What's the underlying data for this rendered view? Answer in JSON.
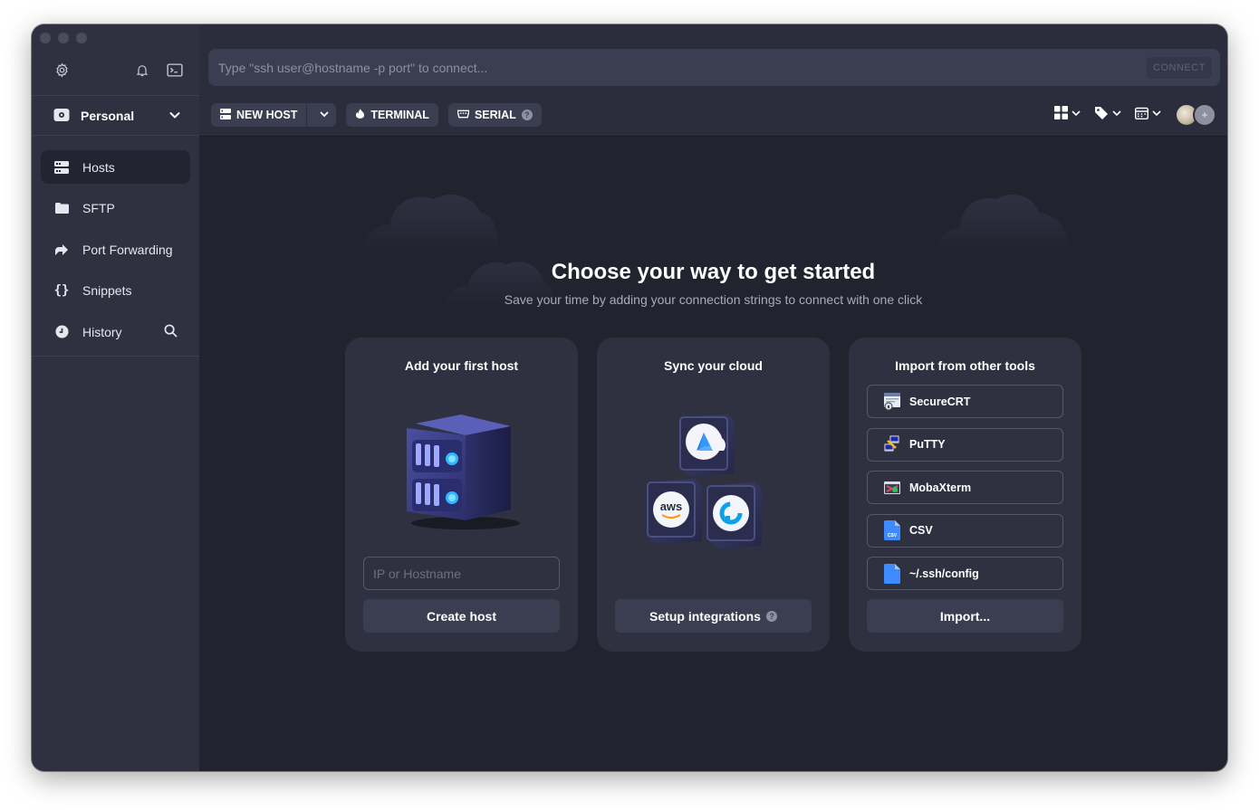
{
  "sidebar": {
    "vault_name": "Personal",
    "items": [
      {
        "label": "Hosts",
        "icon": "hosts-icon",
        "active": true
      },
      {
        "label": "SFTP",
        "icon": "folder-icon"
      },
      {
        "label": "Port Forwarding",
        "icon": "port-forwarding-icon"
      },
      {
        "label": "Snippets",
        "icon": "braces-icon"
      },
      {
        "label": "History",
        "icon": "clock-icon"
      }
    ]
  },
  "quick_connect": {
    "placeholder": "Type \"ssh user@hostname -p port\" to connect...",
    "connect_label": "CONNECT"
  },
  "toolbar": {
    "new_host_label": "NEW HOST",
    "terminal_label": "TERMINAL",
    "serial_label": "SERIAL"
  },
  "hero": {
    "title": "Choose your way to get started",
    "subtitle": "Save your time by adding your connection strings to connect with one click"
  },
  "cards": {
    "add_host": {
      "title": "Add your first host",
      "input_placeholder": "IP or Hostname",
      "button_label": "Create host"
    },
    "sync_cloud": {
      "title": "Sync your cloud",
      "button_label": "Setup integrations",
      "provider_labels": [
        "aws"
      ]
    },
    "import": {
      "title": "Import from other tools",
      "tools": [
        "SecureCRT",
        "PuTTY",
        "MobaXterm",
        "CSV",
        "~/.ssh/config"
      ],
      "csv_icon_label": "CSV",
      "button_label": "Import..."
    }
  },
  "colors": {
    "window_bg": "#21232f",
    "sidebar_bg": "#2f3141",
    "topbar_bg": "#2b2d3c",
    "card_bg": "#2f3141",
    "accent_blue": "#3d8bfd"
  }
}
